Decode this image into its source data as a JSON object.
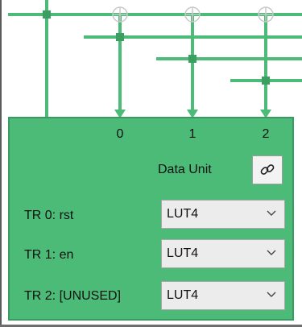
{
  "ports": [
    "0",
    "1",
    "2"
  ],
  "data_unit": {
    "label": "Data Unit",
    "link_icon": "link-icon"
  },
  "triggers": [
    {
      "label": "TR 0: rst",
      "selected": "LUT4"
    },
    {
      "label": "TR 1: en",
      "selected": "LUT4"
    },
    {
      "label": "TR 2: [UNUSED]",
      "selected": "LUT4"
    }
  ],
  "colors": {
    "wire": "#4cbb78",
    "block": "#4cbb78",
    "crosshair": "#c8c8c8"
  }
}
